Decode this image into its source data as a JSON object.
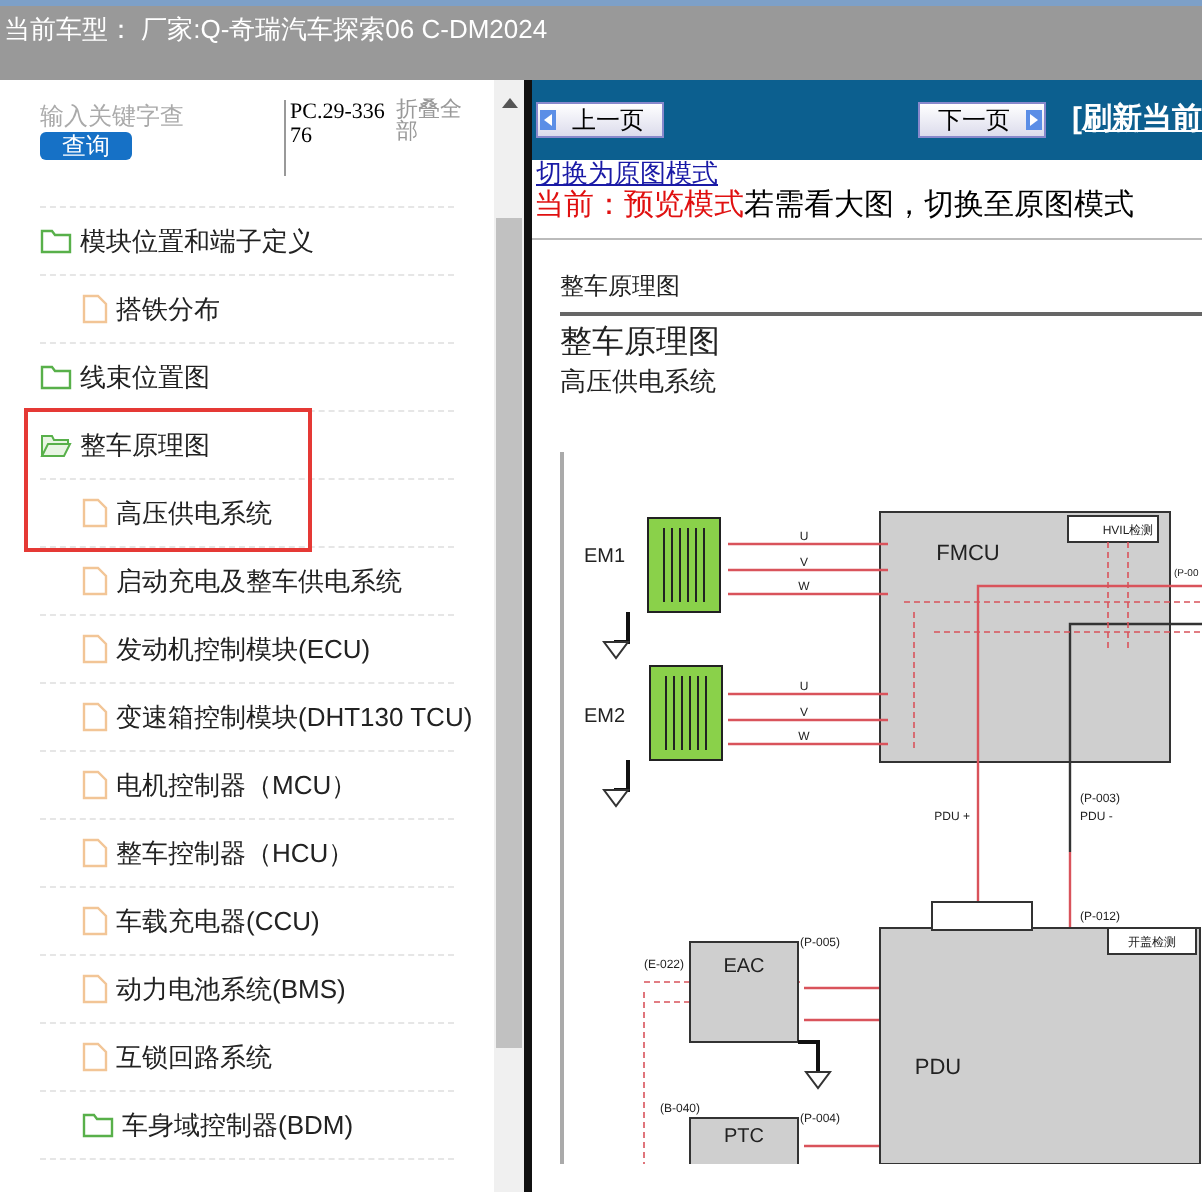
{
  "title_bar": {
    "text": "当前车型： 厂家:Q-奇瑞汽车探索06 C-DM2024"
  },
  "search": {
    "placeholder": "输入关键字查",
    "button": "查询",
    "code": "PC.29-33676",
    "collapse_all": "折叠全部"
  },
  "tree": [
    {
      "label": "模块位置和端子定义",
      "kind": "folder",
      "open": false,
      "highlighted": false,
      "children": [
        {
          "label": "搭铁分布",
          "kind": "page",
          "highlighted": false
        }
      ]
    },
    {
      "label": "线束位置图",
      "kind": "folder",
      "open": false,
      "highlighted": false
    },
    {
      "label": "整车原理图",
      "kind": "folder",
      "open": true,
      "highlighted": true,
      "children": [
        {
          "label": "高压供电系统",
          "kind": "page",
          "highlighted": true
        },
        {
          "label": "启动充电及整车供电系统",
          "kind": "page",
          "highlighted": false
        },
        {
          "label": "发动机控制模块(ECU)",
          "kind": "page",
          "highlighted": false
        },
        {
          "label": "变速箱控制模块(DHT130 TCU)",
          "kind": "page",
          "highlighted": false
        },
        {
          "label": "电机控制器（MCU）",
          "kind": "page",
          "highlighted": false
        },
        {
          "label": "整车控制器（HCU）",
          "kind": "page",
          "highlighted": false
        },
        {
          "label": "车载充电器(CCU)",
          "kind": "page",
          "highlighted": false
        },
        {
          "label": "动力电池系统(BMS)",
          "kind": "page",
          "highlighted": false
        },
        {
          "label": "互锁回路系统",
          "kind": "page",
          "highlighted": false
        },
        {
          "label": "车身域控制器(BDM)",
          "kind": "folder",
          "open": false,
          "highlighted": false
        }
      ]
    }
  ],
  "toolbar": {
    "prev": "上一页",
    "next": "下一页",
    "refresh": "[刷新当前"
  },
  "mode_link": "切换为原图模式",
  "mode_status": {
    "current": "当前：预览模式",
    "hint": "若需看大图，切换至原图模式"
  },
  "document": {
    "header": "整车原理图",
    "title": "整车原理图",
    "subtitle": "高压供电系统",
    "labels": [
      "EM1",
      "EM2",
      "U",
      "V",
      "W",
      "U",
      "V",
      "W",
      "FMCU",
      "HVIL检测",
      "(P-00",
      "(P-003)",
      "PDU +",
      "PDU -",
      "(P-012)",
      "开盖检测",
      "(E-022)",
      "(P-005)",
      "EAC",
      "PDU",
      "(B-040)",
      "(P-004)",
      "PTC"
    ]
  }
}
